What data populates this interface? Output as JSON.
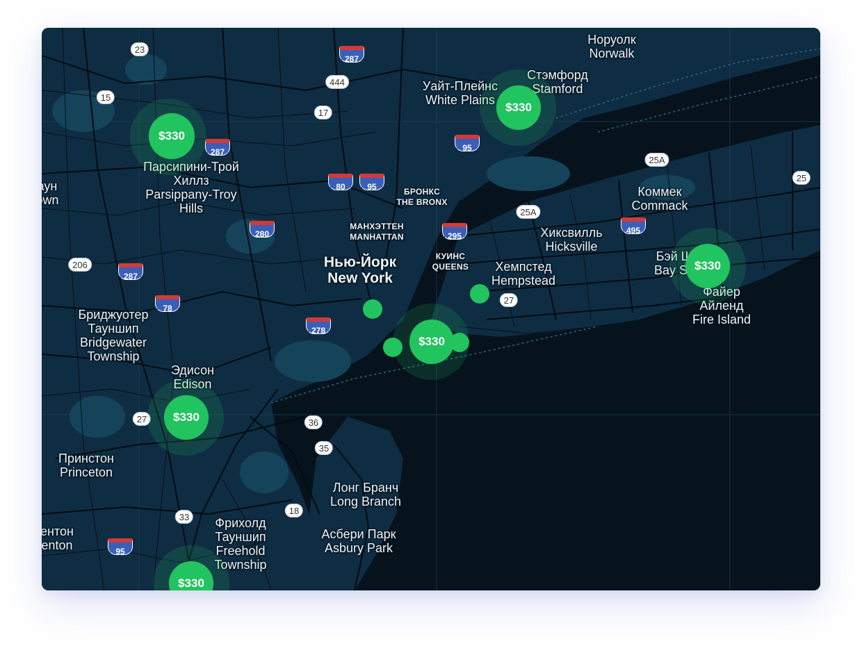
{
  "map": {
    "places": [
      {
        "name": "norwalk",
        "ru": "Норуолк",
        "en": "Norwalk"
      },
      {
        "name": "stamford",
        "ru": "Стэмфорд",
        "en": "Stamford"
      },
      {
        "name": "white-plains",
        "ru": "Уайт-Плейнс",
        "en": "White Plains"
      },
      {
        "name": "parsippany",
        "ru": "Парсипини-Трой Хиллз",
        "en": "Parsippany-Troy Hills"
      },
      {
        "name": "bronx",
        "ru": "БРОНКС",
        "en": "THE BRONX"
      },
      {
        "name": "manhattan",
        "ru": "МАНХЭТТЕН",
        "en": "MANHATTAN"
      },
      {
        "name": "queens",
        "ru": "КУИНС",
        "en": "QUEENS"
      },
      {
        "name": "new-york",
        "ru": "Нью-Йорк",
        "en": "New York"
      },
      {
        "name": "commack",
        "ru": "Коммек",
        "en": "Commack"
      },
      {
        "name": "hicksville",
        "ru": "Хиксвилль",
        "en": "Hicksville"
      },
      {
        "name": "hempstead",
        "ru": "Хемпстед",
        "en": "Hempstead"
      },
      {
        "name": "bay-shore",
        "ru": "Бэй Ш",
        "en": "Bay Sh"
      },
      {
        "name": "fire-island",
        "ru": "Файер Айленд",
        "en": "Fire Island"
      },
      {
        "name": "bridgewater",
        "ru": "Бриджуотер Тауншип",
        "en": "Bridgewater Township"
      },
      {
        "name": "edison",
        "ru": "Эдисон",
        "en": "Edison"
      },
      {
        "name": "princeton",
        "ru": "Принстон",
        "en": "Princeton"
      },
      {
        "name": "long-branch",
        "ru": "Лонг Бранч",
        "en": "Long Branch"
      },
      {
        "name": "freehold",
        "ru": "Фрихолд Тауншип",
        "en": "Freehold Township"
      },
      {
        "name": "asbury-park",
        "ru": "Асбери Парк",
        "en": "Asbury Park"
      },
      {
        "name": "edge-left-1",
        "ru": "аун",
        "en": "own"
      },
      {
        "name": "edge-left-2",
        "ru": "ентон",
        "en": "enton"
      }
    ],
    "route_shields": [
      "23",
      "15",
      "17",
      "444",
      "25A",
      "25",
      "206",
      "27",
      "36",
      "35",
      "18",
      "33"
    ],
    "interstate_shields": [
      "287",
      "287",
      "95",
      "80",
      "95",
      "295",
      "495",
      "280",
      "287",
      "78",
      "278",
      "95"
    ],
    "markers": [
      "$330",
      "$330",
      "$330",
      "$330",
      "$330",
      "$330"
    ]
  }
}
